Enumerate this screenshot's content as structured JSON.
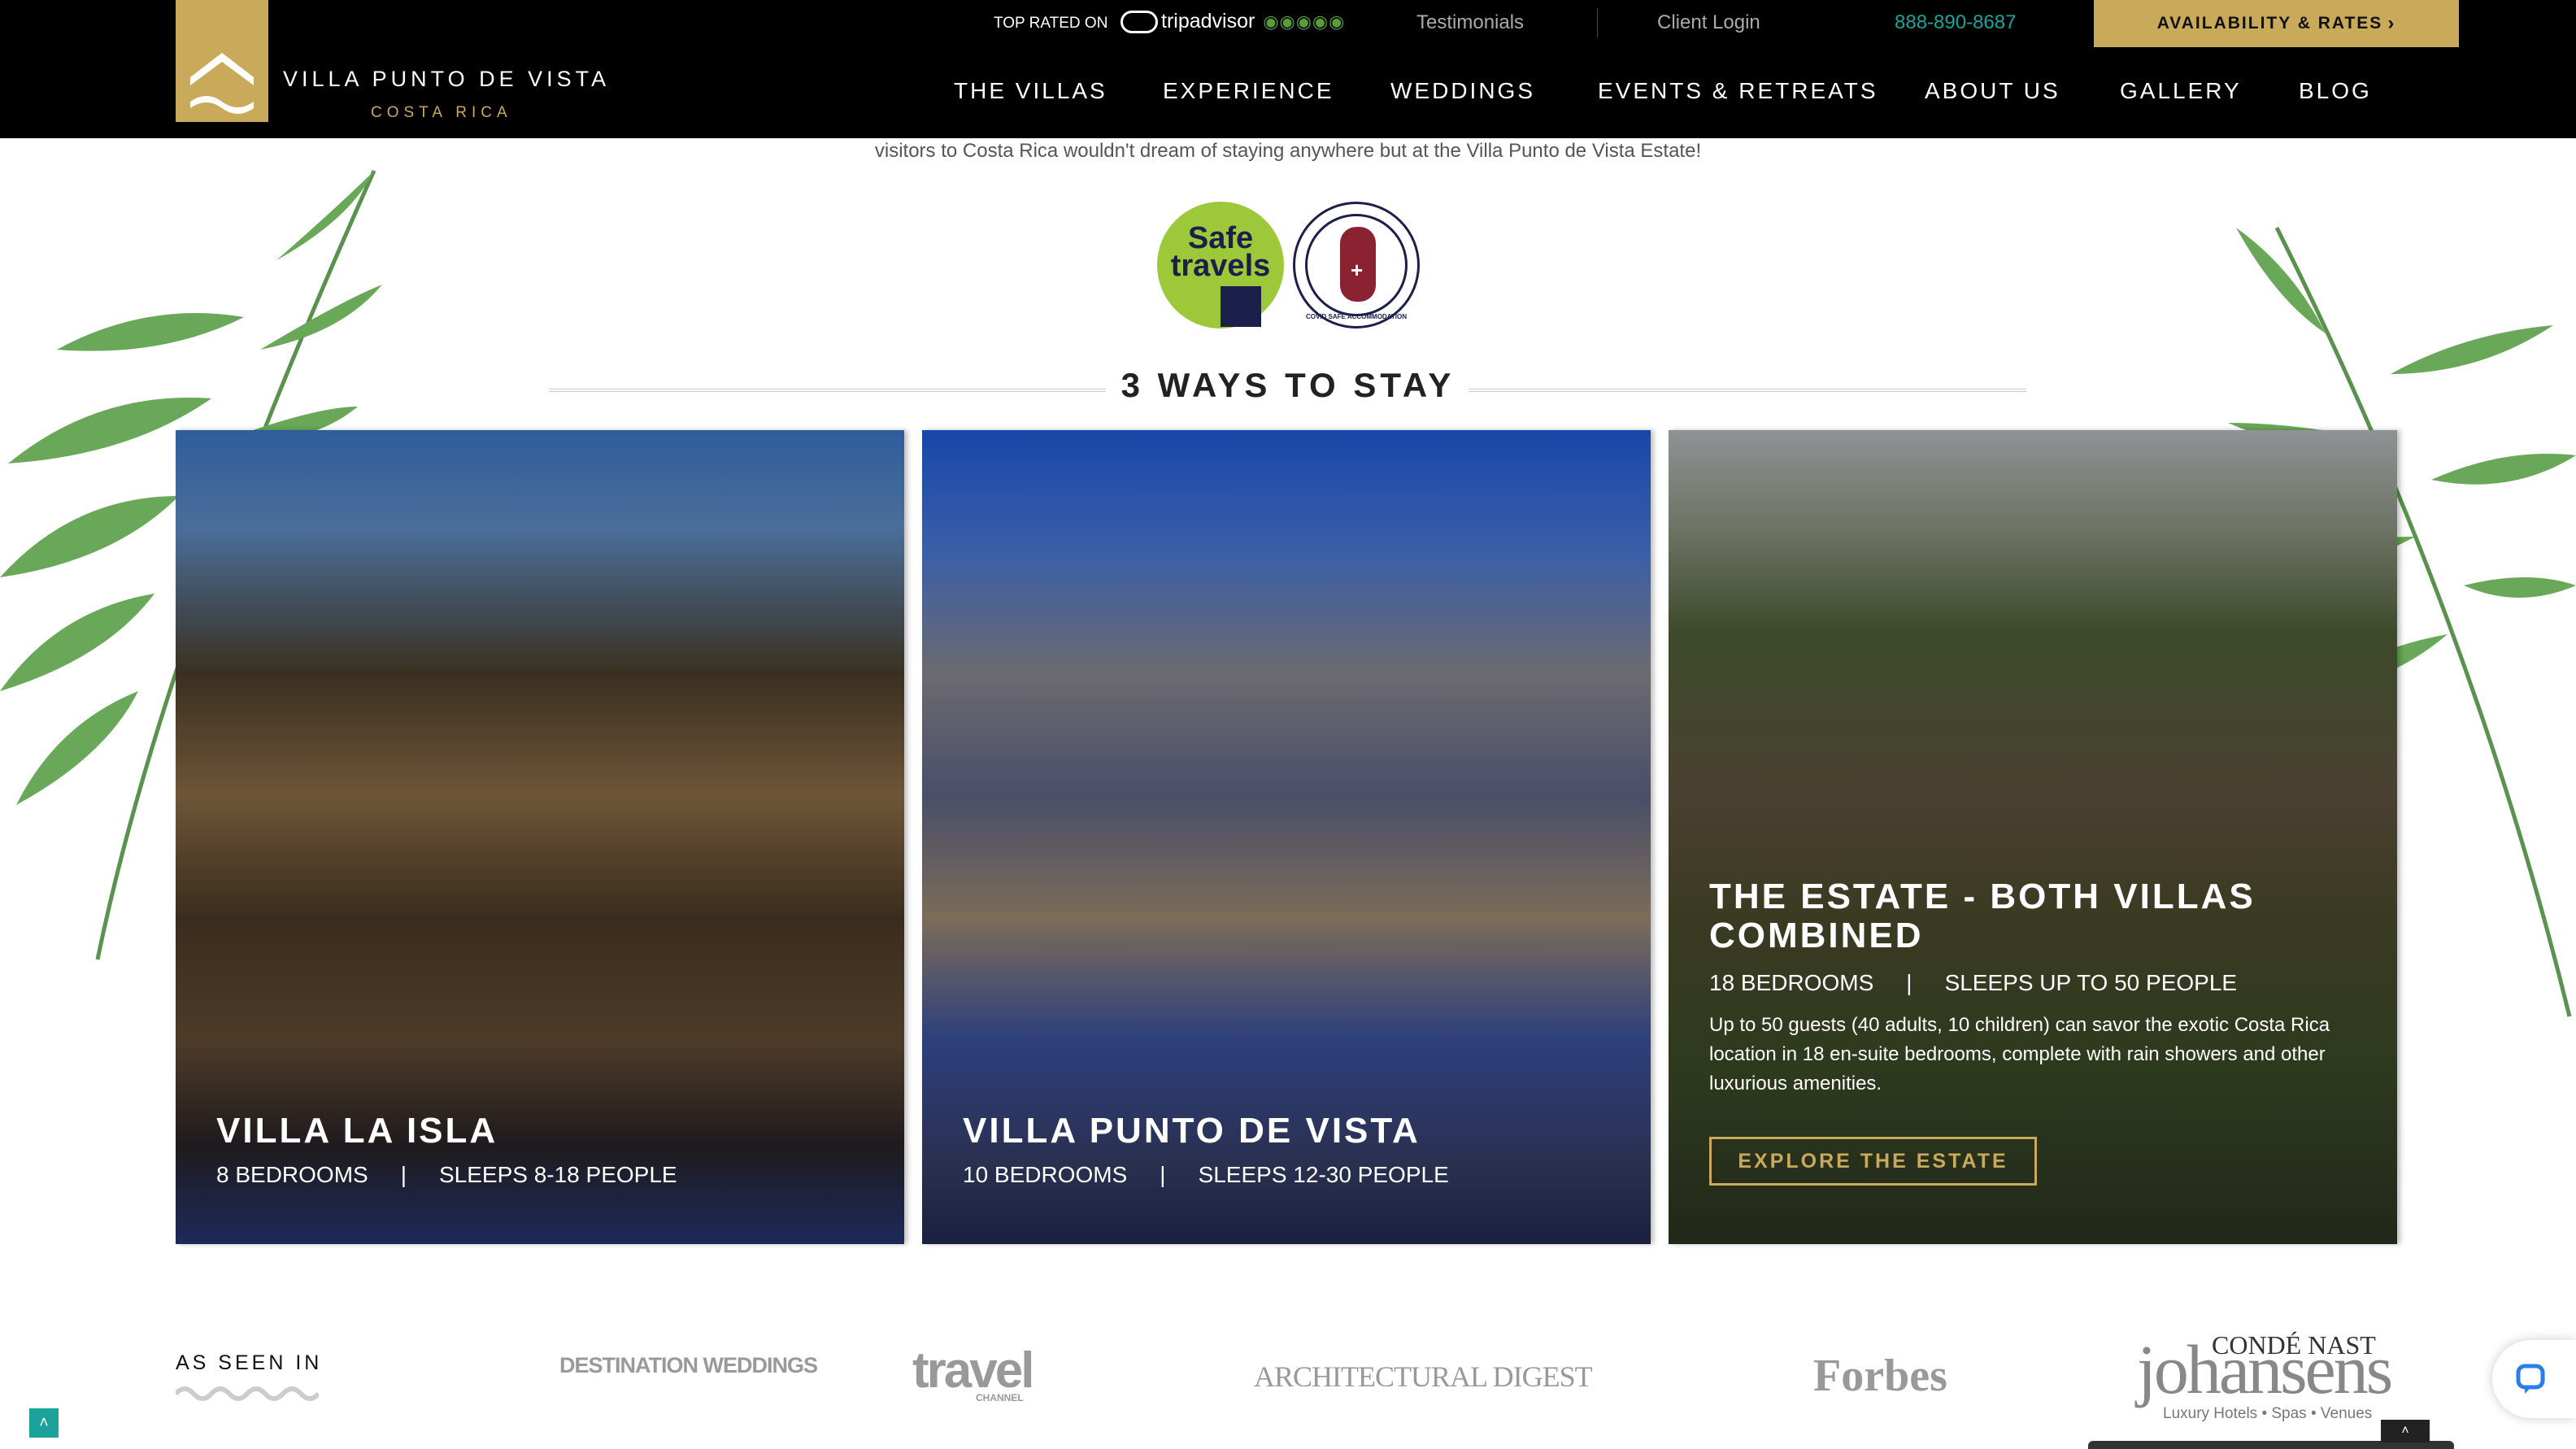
{
  "header": {
    "logo": {
      "name": "VILLA PUNTO DE VISTA",
      "sub": "COSTA RICA"
    },
    "top_rated": "TOP RATED ON",
    "tripadvisor": "tripadvisor",
    "testimonials": "Testimonials",
    "client_login": "Client Login",
    "phone": "888-890-8687",
    "availability": "AVAILABILITY & RATES",
    "nav": [
      "THE VILLAS",
      "EXPERIENCE",
      "WEDDINGS",
      "EVENTS & RETREATS",
      "ABOUT US",
      "GALLERY",
      "BLOG"
    ]
  },
  "intro": "visitors to Costa Rica wouldn't dream of staying anywhere but at the Villa Punto de Vista Estate!",
  "badges": {
    "safe_travels": [
      "Safe",
      "travels"
    ],
    "covid": "COVID SAFE ACCOMMODATION"
  },
  "section_title": "3 WAYS TO STAY",
  "cards": [
    {
      "title": "VILLA LA ISLA",
      "bedrooms": "8 BEDROOMS",
      "sleeps": "SLEEPS 8-18 PEOPLE"
    },
    {
      "title": "VILLA PUNTO DE VISTA",
      "bedrooms": "10 BEDROOMS",
      "sleeps": "SLEEPS 12-30 PEOPLE"
    },
    {
      "title": "THE ESTATE - BOTH VILLAS COMBINED",
      "bedrooms": "18 BEDROOMS",
      "sleeps": "SLEEPS UP TO 50 PEOPLE",
      "description": "Up to 50 guests (40 adults, 10 children) can savor the exotic Costa Rica location in 18 en-suite bedrooms, complete with rain showers and other luxurious amenities.",
      "button": "EXPLORE THE ESTATE"
    }
  ],
  "as_seen_in": {
    "label": "AS SEEN IN",
    "logos": [
      "DESTINATION WEDDINGS",
      "travel",
      "ARCHITECTURAL DIGEST",
      "Forbes",
      "CONDÉ NAST",
      "johansens",
      "Luxury Hotels • Spas • Venues"
    ],
    "travel_sub": "CHANNEL"
  },
  "colors": {
    "gold": "#c9a95a",
    "teal": "#1aa39a",
    "black": "#000000"
  }
}
